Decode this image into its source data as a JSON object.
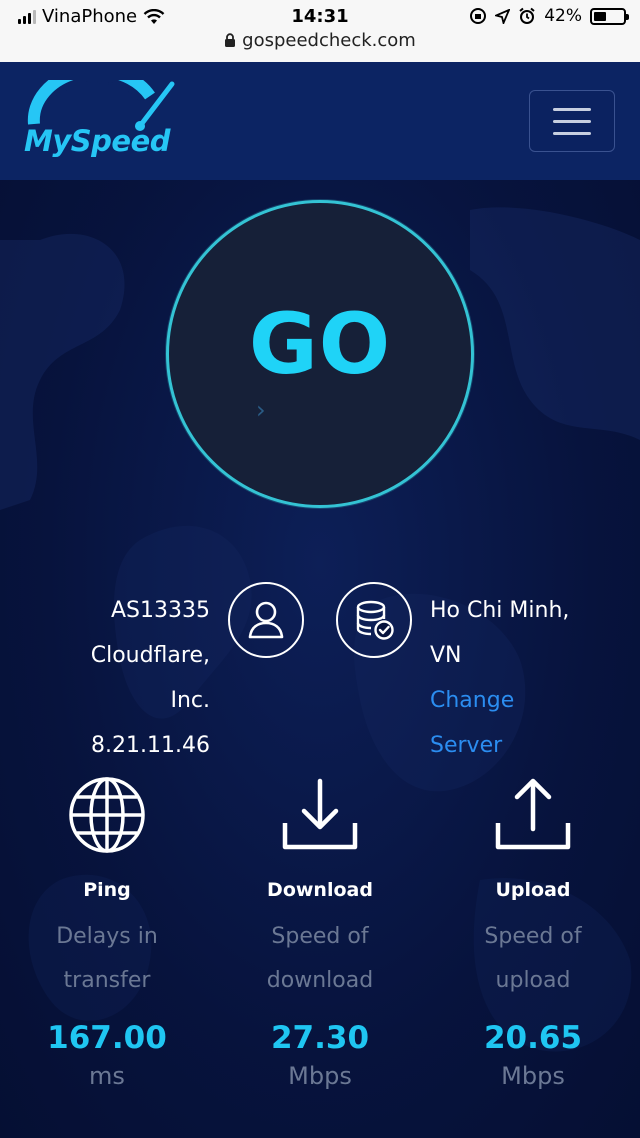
{
  "status_bar": {
    "carrier": "VinaPhone",
    "time": "14:31",
    "battery": "42%",
    "battery_level": 0.42
  },
  "browser": {
    "url": "gospeedcheck.com"
  },
  "header": {
    "logo_text": "MySpeed",
    "menu_icon": "hamburger-icon"
  },
  "test": {
    "go_label": "GO"
  },
  "isp": {
    "asn": "AS13335",
    "name_line1": "Cloudflare,",
    "name_line2": "Inc.",
    "ip": "8.21.11.46"
  },
  "server": {
    "location_line1": "Ho Chi Minh,",
    "location_line2": "VN",
    "change_line1": "Change",
    "change_line2": "Server"
  },
  "stats": {
    "ping": {
      "label": "Ping",
      "desc_line1": "Delays in",
      "desc_line2": "transfer",
      "value": "167.00",
      "unit": "ms",
      "icon": "globe-icon"
    },
    "download": {
      "label": "Download",
      "desc_line1": "Speed of",
      "desc_line2": "download",
      "value": "27.30",
      "unit": "Mbps",
      "icon": "download-icon"
    },
    "upload": {
      "label": "Upload",
      "desc_line1": "Speed of",
      "desc_line2": "upload",
      "value": "20.65",
      "unit": "Mbps",
      "icon": "upload-icon"
    }
  },
  "colors": {
    "accent": "#1fc6f2",
    "link": "#2b8df0",
    "background": "#07133d",
    "header": "#0c2463"
  }
}
